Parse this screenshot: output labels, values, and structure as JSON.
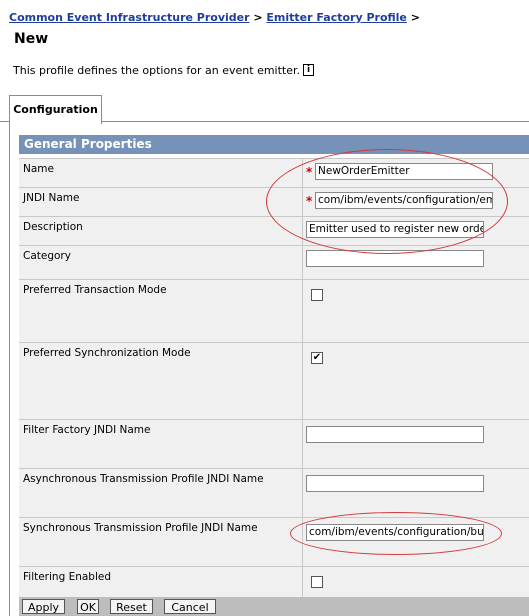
{
  "breadcrumb": {
    "link1": "Common Event Infrastructure Provider",
    "sep1": " > ",
    "link2": "Emitter Factory Profile",
    "sep2": " >"
  },
  "page": {
    "title": "New",
    "description": "This profile defines the options for an event emitter.",
    "info_icon": "i"
  },
  "tabs": {
    "configuration": "Configuration"
  },
  "section": {
    "title": "General Properties"
  },
  "fields": {
    "name": {
      "label": "Name",
      "value": "NewOrderEmitter",
      "required": "*"
    },
    "jndi": {
      "label": "JNDI Name",
      "value": "com/ibm/events/configuration/emitter",
      "required": "*"
    },
    "description": {
      "label": "Description",
      "value": "Emitter used to register new orders"
    },
    "category": {
      "label": "Category",
      "value": ""
    },
    "pref_tx": {
      "label": "Preferred Transaction Mode",
      "checked": ""
    },
    "pref_sync": {
      "label": "Preferred Synchronization Mode",
      "checked": "✔"
    },
    "filter_factory": {
      "label": "Filter Factory JNDI Name",
      "value": ""
    },
    "async_profile": {
      "label": "Asynchronous Transmission Profile JNDI Name",
      "value": ""
    },
    "sync_profile": {
      "label": "Synchronous Transmission Profile JNDI Name",
      "value": "com/ibm/events/configuration/bus-tra"
    },
    "filtering": {
      "label": "Filtering Enabled",
      "checked": ""
    }
  },
  "buttons": {
    "apply": "Apply",
    "ok": "OK",
    "reset": "Reset",
    "cancel": "Cancel"
  },
  "colors": {
    "header": "#7792b9",
    "link": "#1e3e9a",
    "annotation": "#d23a3a"
  }
}
